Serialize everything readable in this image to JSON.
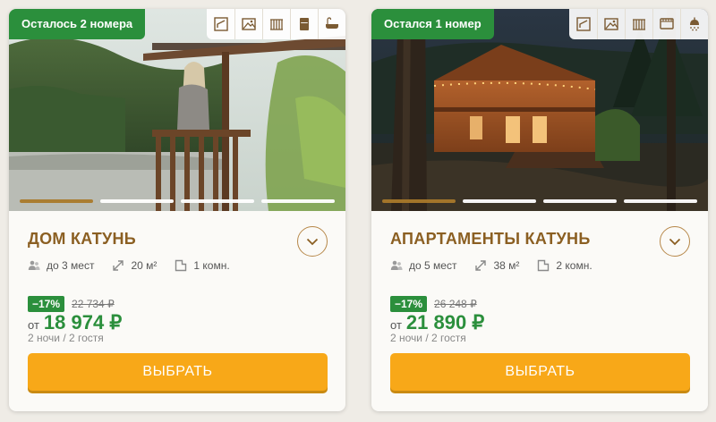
{
  "cards": [
    {
      "badge": "Осталось 2 номера",
      "amenities": [
        "bed-icon",
        "landscape-icon",
        "balcony-icon",
        "fridge-icon",
        "bathtub-icon"
      ],
      "carousel": {
        "slides": 4,
        "active": 0
      },
      "title": "ДОМ КАТУНЬ",
      "features": {
        "guests": "до 3 мест",
        "area": "20 м²",
        "rooms": "1 комн."
      },
      "discount": "−17%",
      "old_price": "22 734 ₽",
      "price_from": "от",
      "price": "18 974 ₽",
      "nights": "2 ночи / 2 гостя",
      "button": "ВЫБРАТЬ"
    },
    {
      "badge": "Остался 1 номер",
      "amenities": [
        "bed-icon",
        "landscape-icon",
        "balcony-icon",
        "tv-icon",
        "shower-icon"
      ],
      "carousel": {
        "slides": 4,
        "active": 0
      },
      "title": "АПАРТАМЕНТЫ КАТУНЬ",
      "features": {
        "guests": "до 5 мест",
        "area": "38 м²",
        "rooms": "2 комн."
      },
      "discount": "−17%",
      "old_price": "26 248 ₽",
      "price_from": "от",
      "price": "21 890 ₽",
      "nights": "2 ночи / 2 гостя",
      "button": "ВЫБРАТЬ"
    }
  ],
  "colors": {
    "accent_green": "#2b8f3c",
    "title_brown": "#8b5f22",
    "button_orange": "#f8a818",
    "dot_active": "#a9792a"
  }
}
